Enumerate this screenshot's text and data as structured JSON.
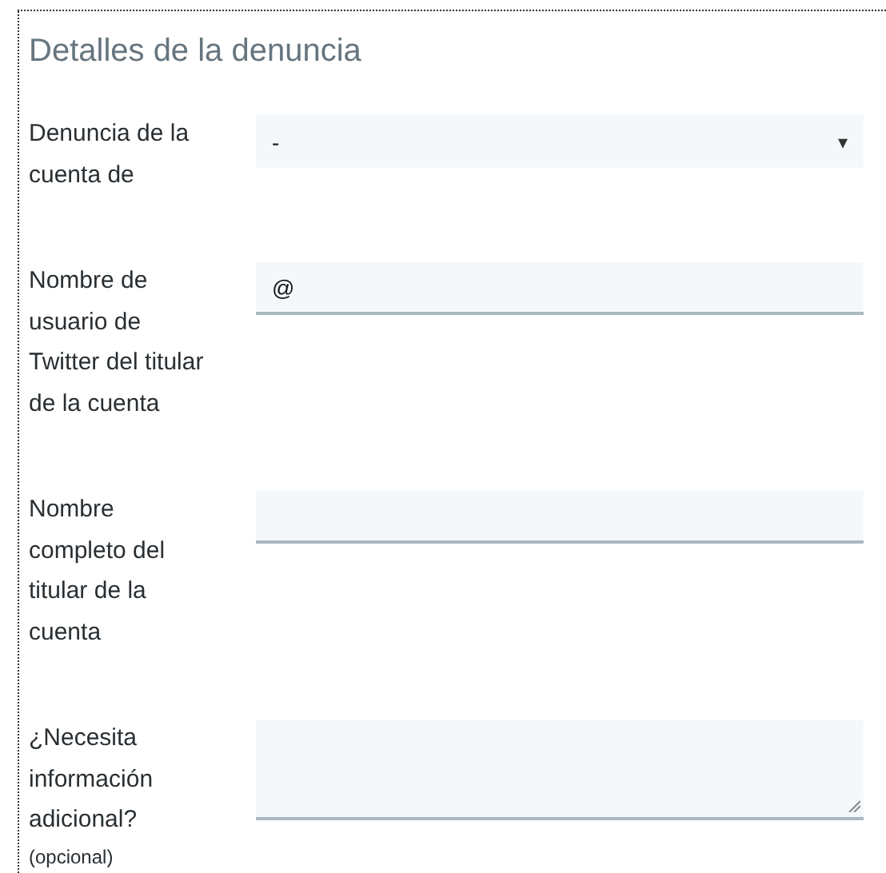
{
  "title": "Detalles de la denuncia",
  "fields": [
    {
      "kind": "select",
      "label": "Denuncia de la\ncuenta de",
      "value": "-",
      "caret": "▾"
    },
    {
      "kind": "text",
      "label": "Nombre de\nusuario de\nTwitter del titular\nde la cuenta",
      "value": "@"
    },
    {
      "kind": "text",
      "label": "Nombre\ncompleto del\ntitular de la\ncuenta"
    },
    {
      "kind": "textarea",
      "label": "¿Necesita\ninformación\nadicional?",
      "note": "(opcional)"
    }
  ]
}
